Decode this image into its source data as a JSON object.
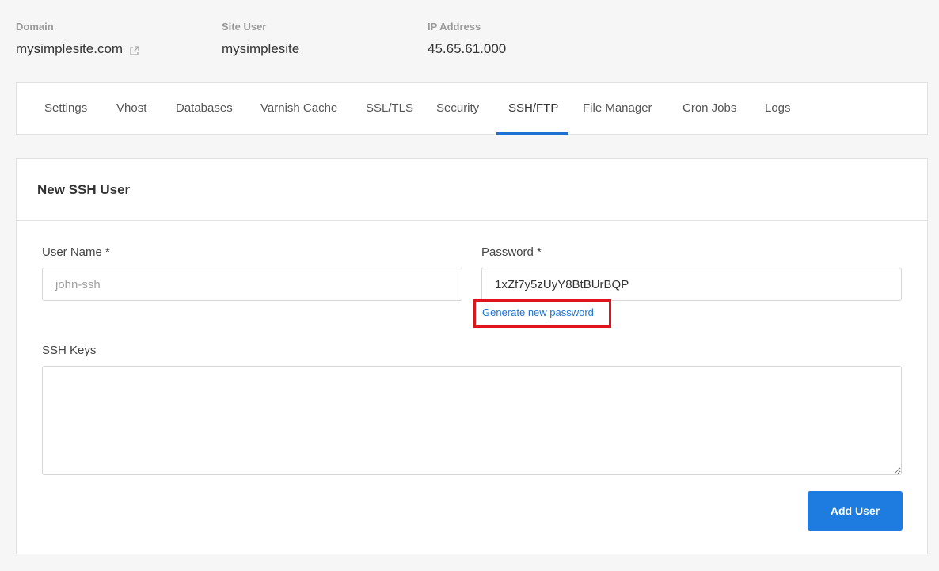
{
  "site_info": {
    "domain": {
      "label": "Domain",
      "value": "mysimplesite.com",
      "icon": "external-link-icon"
    },
    "site_user": {
      "label": "Site User",
      "value": "mysimplesite"
    },
    "ip_address": {
      "label": "IP Address",
      "value": "45.65.61.000"
    }
  },
  "tabs": [
    {
      "label": "Settings",
      "active": false
    },
    {
      "label": "Vhost",
      "active": false
    },
    {
      "label": "Databases",
      "active": false
    },
    {
      "label": "Varnish Cache",
      "active": false
    },
    {
      "label": "SSL/TLS",
      "active": false
    },
    {
      "label": "Security",
      "active": false
    },
    {
      "label": "SSH/FTP",
      "active": true
    },
    {
      "label": "File Manager",
      "active": false
    },
    {
      "label": "Cron Jobs",
      "active": false
    },
    {
      "label": "Logs",
      "active": false
    }
  ],
  "form": {
    "title": "New SSH User",
    "username": {
      "label": "User Name *",
      "placeholder": "john-ssh",
      "value": ""
    },
    "password": {
      "label": "Password *",
      "value": "1xZf7y5zUyY8BtBUrBQP"
    },
    "generate_link": "Generate new password",
    "ssh_keys": {
      "label": "SSH Keys",
      "value": ""
    },
    "submit_label": "Add User"
  },
  "colors": {
    "accent": "#1e73d2",
    "button": "#1e7be0",
    "highlight_box": "#e0141e"
  }
}
